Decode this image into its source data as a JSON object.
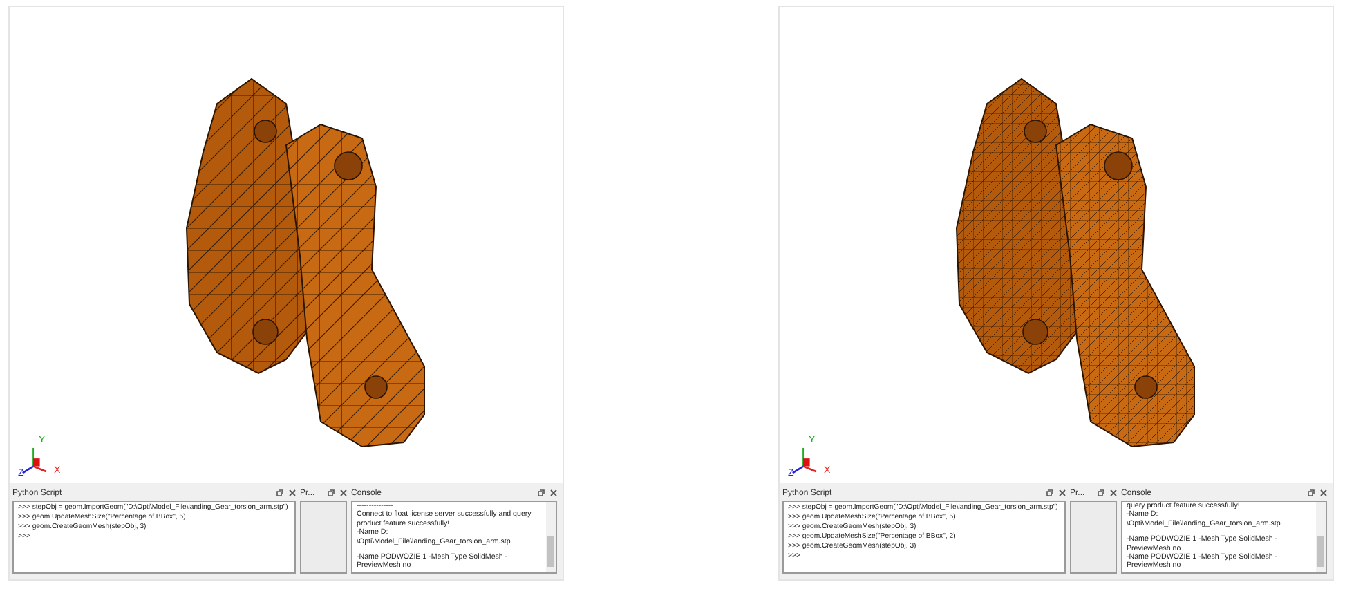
{
  "viewers": [
    {
      "fine_mesh": false,
      "axes": [
        "Y",
        "Z",
        "X"
      ],
      "python_script": {
        "title": "Python Script",
        "lines": [
          ">>> stepObj = geom.ImportGeom(\"D:\\Opti\\Model_File\\landing_Gear_torsion_arm.stp\")",
          ">>> geom.UpdateMeshSize(\"Percentage of BBox\", 5)",
          ">>> geom.CreateGeomMesh(stepObj, 3)",
          ">>>"
        ]
      },
      "properties": {
        "title": "Pr..."
      },
      "console": {
        "title": "Console",
        "paragraphs": [
          [
            "---------------",
            "Connect to float license server successfully and query product feature successfully!",
            "-Name D:",
            "\\Opti\\Model_File\\landing_Gear_torsion_arm.stp"
          ],
          [
            "-Name PODWOZIE 1 -Mesh Type SolidMesh - PreviewMesh no"
          ]
        ]
      }
    },
    {
      "fine_mesh": true,
      "axes": [
        "Y",
        "Z",
        "X"
      ],
      "python_script": {
        "title": "Python Script",
        "lines": [
          ">>> stepObj = geom.ImportGeom(\"D:\\Opti\\Model_File\\landing_Gear_torsion_arm.stp\")",
          ">>> geom.UpdateMeshSize(\"Percentage of BBox\", 5)",
          ">>> geom.CreateGeomMesh(stepObj, 3)",
          ">>> geom.UpdateMeshSize(\"Percentage of BBox\", 2)",
          ">>> geom.CreateGeomMesh(stepObj, 3)",
          ">>>"
        ]
      },
      "properties": {
        "title": "Pr..."
      },
      "console": {
        "title": "Console",
        "paragraphs": [
          [
            "query product feature successfully!",
            "-Name D:",
            "\\Opti\\Model_File\\landing_Gear_torsion_arm.stp"
          ],
          [
            "-Name PODWOZIE 1 -Mesh Type SolidMesh - PreviewMesh no",
            "-Name PODWOZIE 1 -Mesh Type SolidMesh - PreviewMesh no"
          ]
        ]
      }
    }
  ]
}
